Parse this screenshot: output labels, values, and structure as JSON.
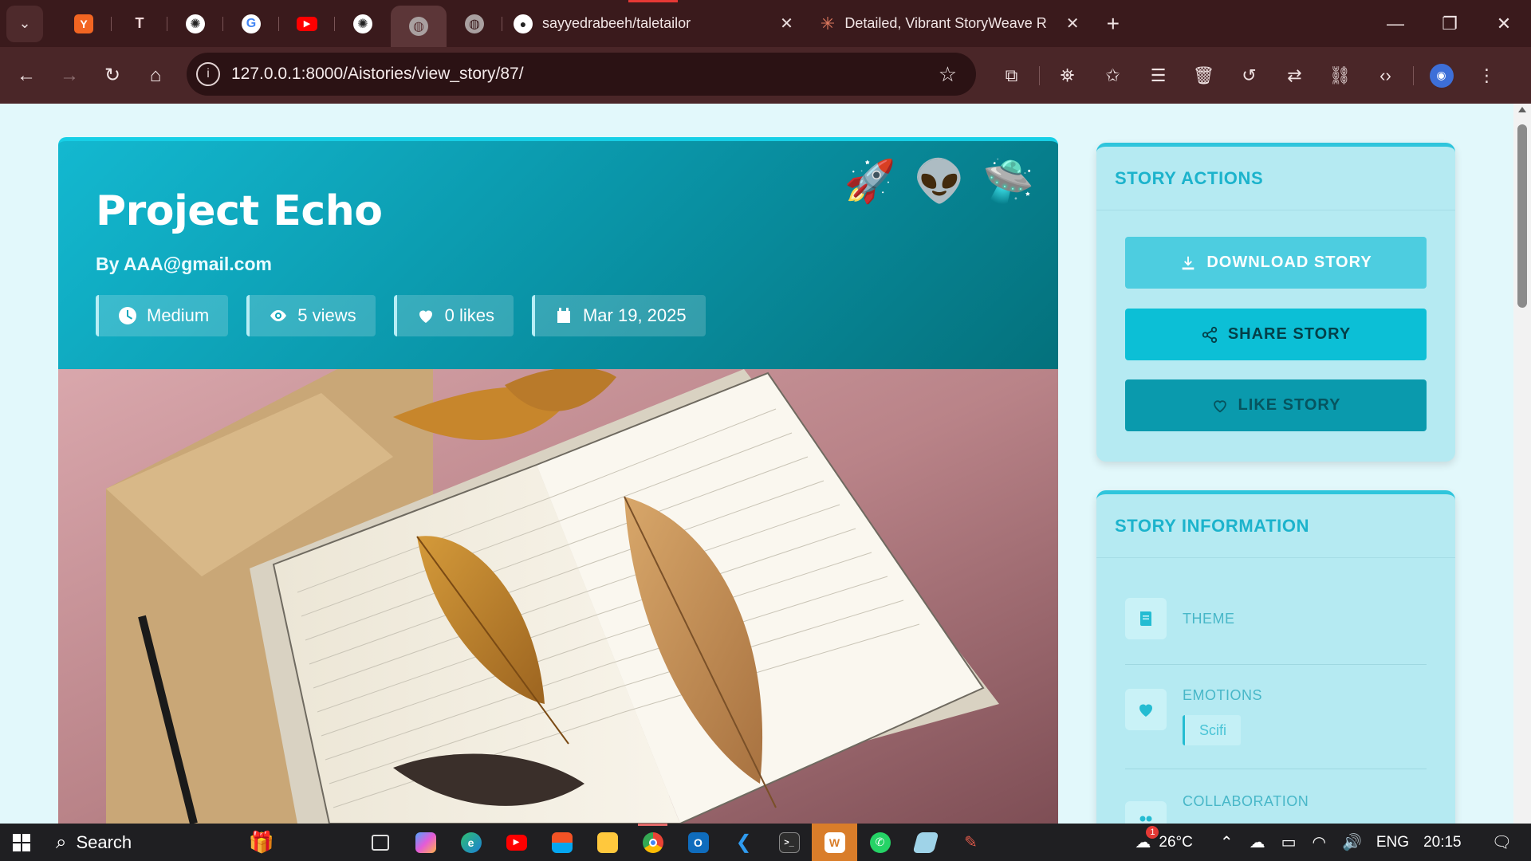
{
  "browser": {
    "tabs": [
      {
        "icon": "Y",
        "color": "#f26522"
      },
      {
        "icon": "T",
        "color": "#c0392b"
      },
      {
        "icon": "✺",
        "color": "#3a1a1c"
      },
      {
        "icon": "G",
        "color": "#ffffff"
      },
      {
        "icon": "▶",
        "color": "#ff0000"
      },
      {
        "icon": "✺",
        "color": "#3a1a1c"
      },
      {
        "icon": "◍",
        "color": "#5c3638"
      },
      {
        "icon": "◍",
        "color": "#3a1a1c"
      }
    ],
    "tab_github_title": "sayyedrabeeh/taletailor",
    "tab_claude_title": "Detailed, Vibrant StoryWeave R",
    "new_tab": "+",
    "close": "✕",
    "url": "127.0.0.1:8000/Aistories/view_story/87/"
  },
  "story": {
    "title": "Project Echo",
    "author": "By AAA@gmail.com",
    "length": "Medium",
    "views": "5 views",
    "likes": "0 likes",
    "date": "Mar 19, 2025",
    "emojis": [
      "🚀",
      "👽",
      "🛸"
    ]
  },
  "actions": {
    "heading": "STORY ACTIONS",
    "download": "DOWNLOAD STORY",
    "share": "SHARE STORY",
    "like": "LIKE STORY"
  },
  "info": {
    "heading": "STORY INFORMATION",
    "theme_label": "THEME",
    "emotions_label": "EMOTIONS",
    "emotion_tag": "Scifi",
    "collaboration_label": "COLLABORATION"
  },
  "taskbar": {
    "search": "Search",
    "weather": "26°C",
    "weather_badge": "1",
    "language": "ENG",
    "time": "20:15"
  },
  "colors": {
    "hero_start": "#13b8d0",
    "hero_end": "#04717c",
    "accent": "#1cb3cc",
    "sidebar_bg": "#b5eaf2"
  }
}
